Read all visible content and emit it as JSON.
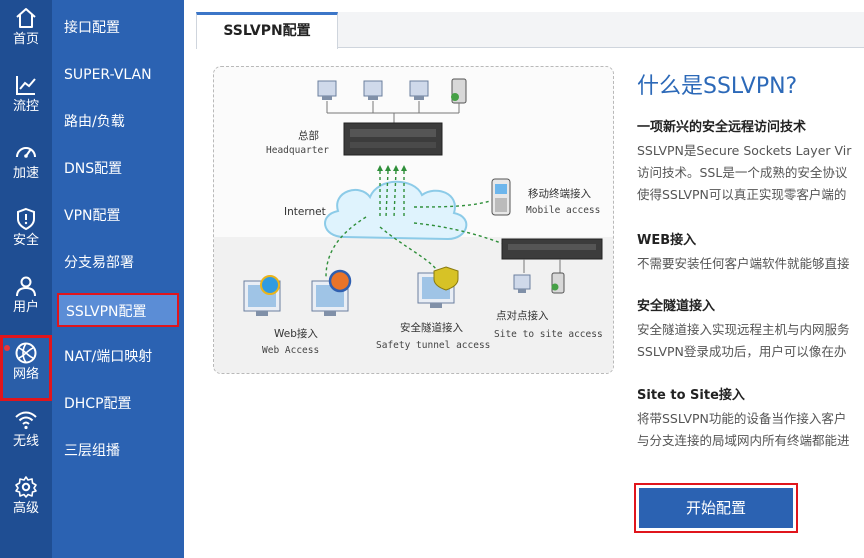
{
  "rail": {
    "items": [
      {
        "label": "首页",
        "icon": "home-icon"
      },
      {
        "label": "流控",
        "icon": "chart-icon"
      },
      {
        "label": "加速",
        "icon": "speedometer-icon"
      },
      {
        "label": "安全",
        "icon": "shield-icon"
      },
      {
        "label": "用户",
        "icon": "user-icon"
      },
      {
        "label": "网络",
        "icon": "globe-icon"
      },
      {
        "label": "无线",
        "icon": "wifi-icon"
      },
      {
        "label": "高级",
        "icon": "gear-icon"
      }
    ],
    "active_index": 5
  },
  "submenu": {
    "items": [
      "接口配置",
      "SUPER-VLAN",
      "路由/负载",
      "DNS配置",
      "VPN配置",
      "分支易部署",
      "SSLVPN配置",
      "NAT/端口映射",
      "DHCP配置",
      "三层组播"
    ],
    "active_index": 6
  },
  "tab": {
    "label": "SSLVPN配置"
  },
  "diagram": {
    "hq_cn": "总部",
    "hq_en": "Headquarter",
    "internet": "Internet",
    "mobile_cn": "移动终端接入",
    "mobile_en": "Mobile access",
    "web_cn": "Web接入",
    "web_en": "Web Access",
    "tunnel_cn": "安全隧道接入",
    "tunnel_en": "Safety tunnel access",
    "site_cn": "点对点接入",
    "site_en": "Site to site access"
  },
  "info": {
    "title": "什么是SSLVPN?",
    "sections": [
      {
        "title": "一项新兴的安全远程访问技术",
        "lines": [
          "SSLVPN是Secure Sockets Layer Vir",
          "访问技术。SSL是一个成熟的安全协议",
          "使得SSLVPN可以真正实现零客户端的"
        ]
      },
      {
        "title": "WEB接入",
        "lines": [
          "不需要安装任何客户端软件就能够直接"
        ]
      },
      {
        "title": "安全隧道接入",
        "lines": [
          "安全隧道接入实现远程主机与内网服务",
          "SSLVPN登录成功后，用户可以像在办"
        ]
      },
      {
        "title": "Site to Site接入",
        "lines": [
          "将带SSLVPN功能的设备当作接入客户",
          "与分支连接的局域网内所有终端都能进"
        ]
      }
    ]
  },
  "start_button": {
    "label": "开始配置"
  },
  "colors": {
    "rail_bg": "#1f4e93",
    "submenu_bg": "#2b62b2",
    "accent": "#2c69b8",
    "highlight_border": "#e0151c"
  }
}
